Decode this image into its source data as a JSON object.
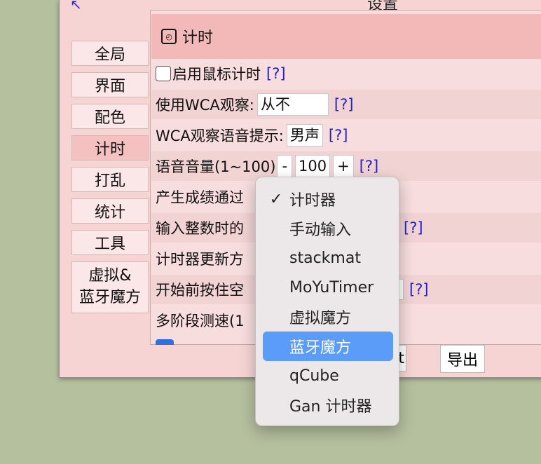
{
  "dialog": {
    "title": "设置"
  },
  "sidebar": {
    "items": [
      {
        "label": "全局"
      },
      {
        "label": "界面"
      },
      {
        "label": "配色"
      },
      {
        "label": "计时"
      },
      {
        "label": "打乱"
      },
      {
        "label": "统计"
      },
      {
        "label": "工具"
      },
      {
        "label_line1": "虚拟&",
        "label_line2": "蓝牙魔方"
      }
    ],
    "active": "计时"
  },
  "panel": {
    "section_title": "计时",
    "help": "[?]",
    "rows": {
      "mouse_timer": "启用鼠标计时",
      "wca_inspection": {
        "label": "使用WCA观察:",
        "value": "从不"
      },
      "wca_voice": {
        "label": "WCA观察语音提示:",
        "value": "男声"
      },
      "volume": {
        "label": "语音音量(1~100)",
        "minus": "-",
        "value": "100",
        "plus": "+"
      },
      "input_via": "产生成绩通过",
      "integer_input": "输入整数时的",
      "update_mode": "计时器更新方",
      "hold_space": "开始前按住空",
      "multiphase": "多阶段测速(1"
    }
  },
  "footer": {
    "import_partial": "t",
    "export_label": "导出"
  },
  "dropdown": {
    "options": [
      "计时器",
      "手动输入",
      "stackmat",
      "MoYuTimer",
      "虚拟魔方",
      "蓝牙魔方",
      "qCube",
      "Gan 计时器"
    ],
    "checked": "计时器",
    "highlighted": "蓝牙魔方",
    "check_glyph": "✓"
  },
  "colors": {
    "background": "#b5c09f",
    "dialog": "#f6d4d4",
    "section_header": "#f3b9b9",
    "help_link": "#2020d0",
    "menu_highlight": "#5a9cf8"
  }
}
